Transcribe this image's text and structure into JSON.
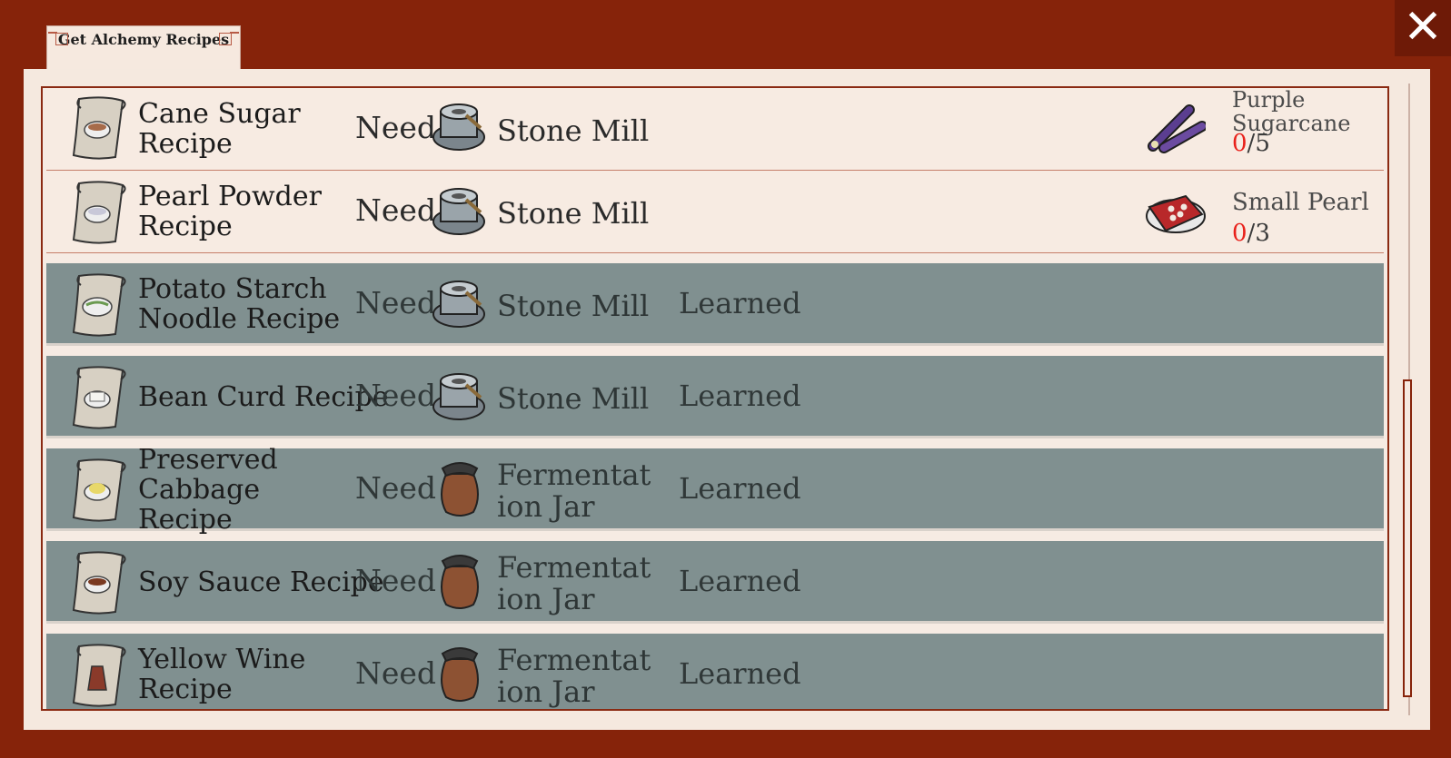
{
  "window": {
    "tab_label": "Get Alchemy Recipes",
    "close_icon": "close-icon"
  },
  "recipes": [
    {
      "name": "Cane Sugar Recipe",
      "need": "Need",
      "tool": "Stone Mill",
      "tool_icon": "stone-mill-icon",
      "material": {
        "name": "Purple Sugarcane",
        "have": "0",
        "sep": "/",
        "required": "5",
        "icon": "purple-sugarcane-icon"
      }
    },
    {
      "name": "Pearl Powder Recipe",
      "need": "Need",
      "tool": "Stone Mill",
      "tool_icon": "stone-mill-icon",
      "material": {
        "name": "Small Pearl",
        "have": "0",
        "sep": "/",
        "required": "3",
        "icon": "small-pearl-icon"
      }
    },
    {
      "name": "Potato Starch Noodle Recipe",
      "need": "Need",
      "tool": "Stone Mill",
      "status": "Learned"
    },
    {
      "name": "Bean Curd Recipe",
      "need": "Need",
      "tool": "Stone Mill",
      "status": "Learned"
    },
    {
      "name": "Preserved Cabbage Recipe",
      "need": "Need",
      "tool": "Fermentation Jar",
      "status": "Learned"
    },
    {
      "name": "Soy Sauce Recipe",
      "need": "Need",
      "tool": "Fermentation Jar",
      "status": "Learned"
    },
    {
      "name": "Yellow Wine Recipe",
      "need": "Need",
      "tool": "Fermentation Jar",
      "status": "Learned"
    }
  ],
  "colors": {
    "frame": "#86230a",
    "panel": "#f5e9df",
    "learned_row": "#809090",
    "count_missing": "#e8201a"
  }
}
